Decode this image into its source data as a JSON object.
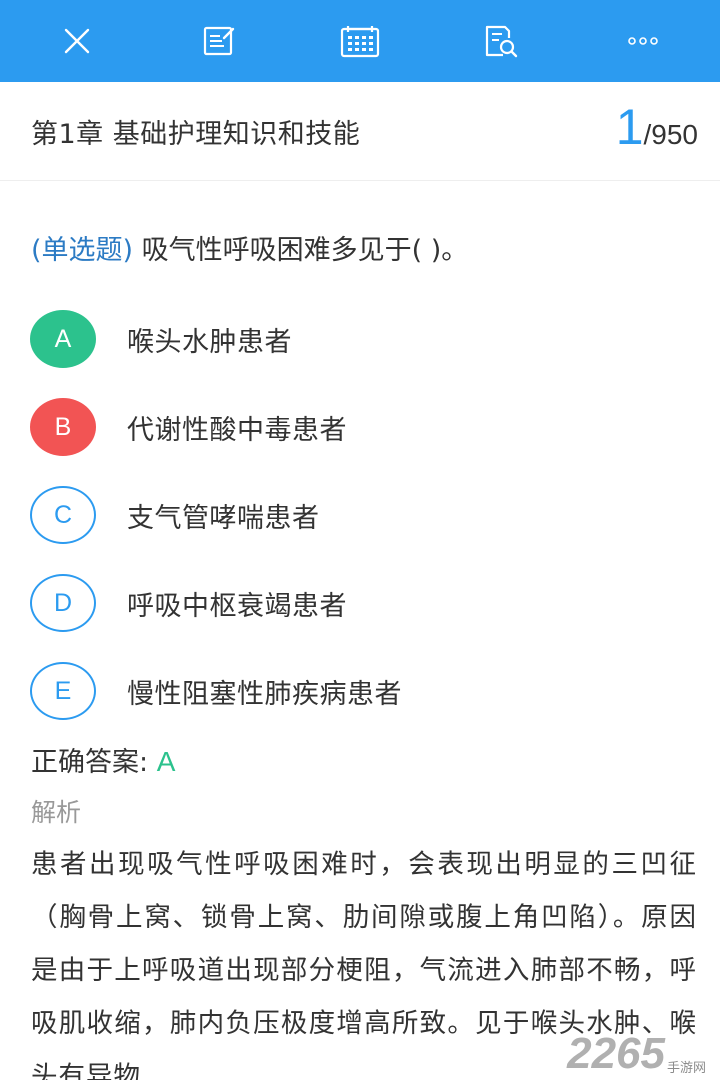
{
  "toolbar": {
    "icons": [
      "close-icon",
      "edit-note-icon",
      "answer-card-icon",
      "search-document-icon",
      "more-icon"
    ],
    "background": "#2c9bf0"
  },
  "chapter": {
    "title": "第1章 基础护理知识和技能",
    "current": "1",
    "total": "/950"
  },
  "question": {
    "type": "(单选题)",
    "text": " 吸气性呼吸困难多见于( )。"
  },
  "options": [
    {
      "letter": "A",
      "text": "喉头水肿患者",
      "state": "correct"
    },
    {
      "letter": "B",
      "text": "代谢性酸中毒患者",
      "state": "wrong"
    },
    {
      "letter": "C",
      "text": "支气管哮喘患者",
      "state": "plain"
    },
    {
      "letter": "D",
      "text": "呼吸中枢衰竭患者",
      "state": "plain"
    },
    {
      "letter": "E",
      "text": "慢性阻塞性肺疾病患者",
      "state": "plain"
    }
  ],
  "answer": {
    "label": "正确答案: ",
    "value": "A"
  },
  "analysis": {
    "label": "解析",
    "text": "患者出现吸气性呼吸困难时，会表现出明显的三凹征（胸骨上窝、锁骨上窝、肋间隙或腹上角凹陷）。原因是由于上呼吸道出现部分梗阻，气流进入肺部不畅，呼吸肌收缩，肺内负压极度增高所致。见于喉头水肿、喉头有异物"
  },
  "watermark": {
    "number": "2265",
    "suffix": "手游网"
  },
  "colors": {
    "accent": "#2c9bf0",
    "correct": "#2cc28d",
    "wrong": "#f25454"
  }
}
